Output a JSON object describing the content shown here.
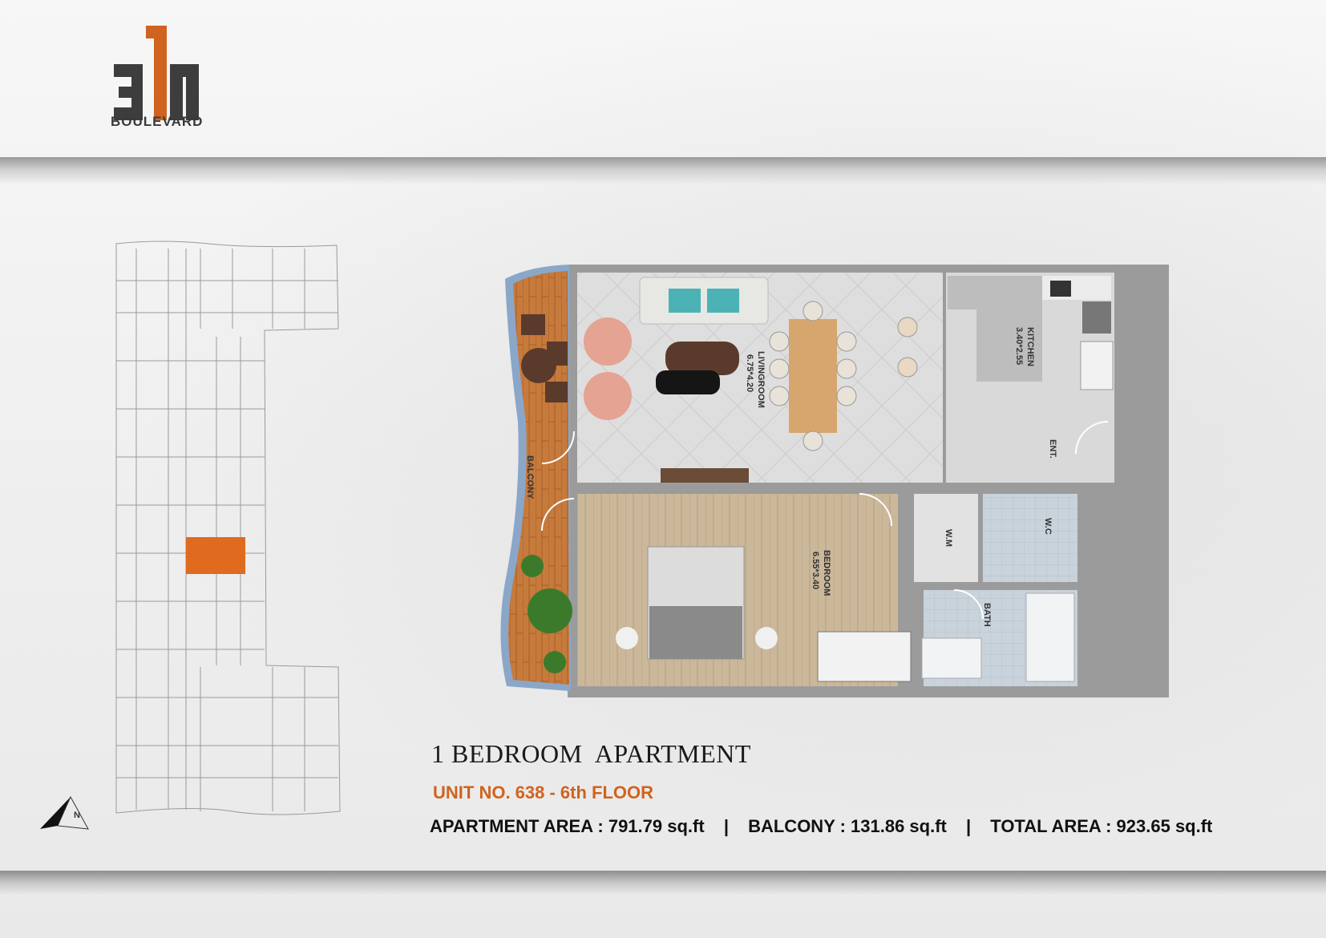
{
  "brand": {
    "logo_text": "311",
    "name": "BOULEVARD",
    "accent_color": "#d0631f"
  },
  "floor_plan": {
    "rooms": {
      "balcony": "BALCONY",
      "living": "LIVINGROOM",
      "living_dim": "6.75*4.20",
      "kitchen": "KITCHEN",
      "kitchen_dim": "3.40*2.55",
      "entrance": "ENT.",
      "bedroom": "BEDROOM",
      "bedroom_dim": "6.55*3.40",
      "wm": "W.M",
      "wc": "W.C",
      "bath": "BATH"
    },
    "highlight_color": "#e06a1e"
  },
  "title": "1 BEDROOM  APARTMENT",
  "unit": "UNIT NO.  638 - 6th FLOOR",
  "areas": {
    "apartment": "APARTMENT AREA : 791.79 sq.ft",
    "balcony": "BALCONY : 131.86 sq.ft",
    "total": "TOTAL AREA : 923.65 sq.ft",
    "separator": "|"
  },
  "compass": {
    "label": "N"
  }
}
